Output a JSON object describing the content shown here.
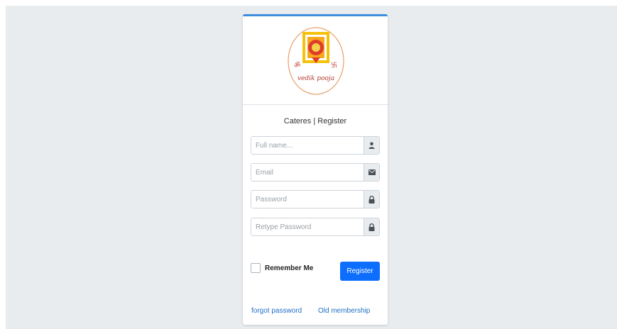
{
  "colors": {
    "accent": "#0d6efd",
    "card_top_border": "#3c8dde",
    "link": "#1f6fc5",
    "page_background": "#e9ecef"
  },
  "logo": {
    "text": "vedik pooja",
    "left_symbol": "ॐ",
    "right_symbol": "卐"
  },
  "box_message": "Cateres | Register",
  "form": {
    "fullname": {
      "placeholder": "Full name...",
      "value": "",
      "icon": "user-icon"
    },
    "email": {
      "placeholder": "Email",
      "value": "",
      "icon": "envelope-icon"
    },
    "password": {
      "placeholder": "Password",
      "value": "",
      "icon": "lock-icon"
    },
    "retype_password": {
      "placeholder": "Retype Password",
      "value": "",
      "icon": "lock-icon"
    },
    "remember_label": "Remember Me",
    "remember_checked": false,
    "register_label": "Register"
  },
  "links": {
    "forgot_password": "forgot password",
    "old_membership": "Old membership"
  }
}
